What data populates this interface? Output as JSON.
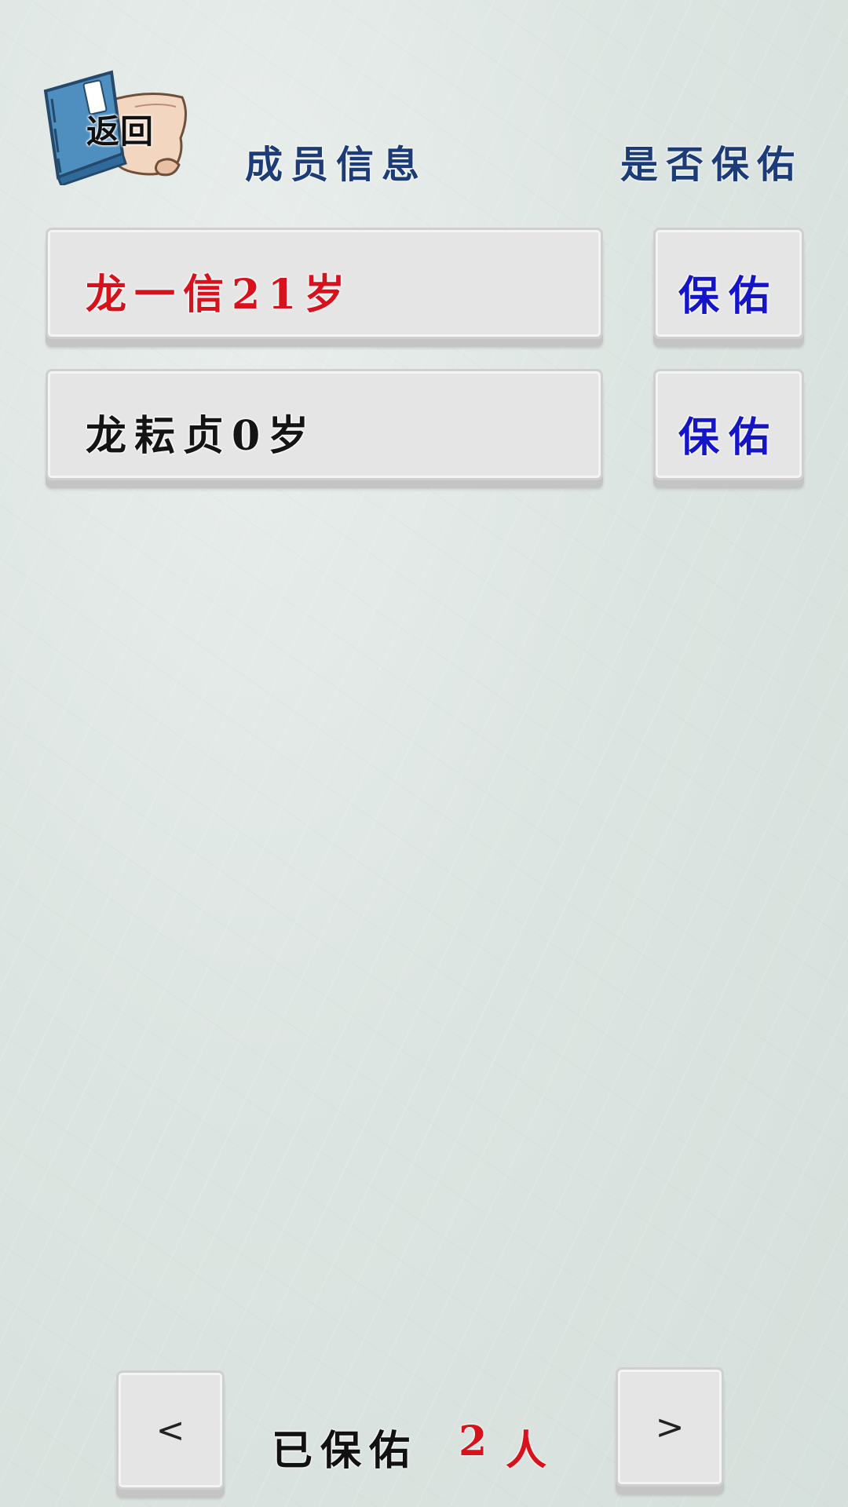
{
  "back_button": {
    "label": "返回"
  },
  "headers": {
    "member_info": "成员信息",
    "protect_column": "是否保佑"
  },
  "members": [
    {
      "name_age": "龙一信21岁",
      "color": "#d8121c",
      "action": "保佑"
    },
    {
      "name_age": "龙耘贞0岁",
      "color": "#141414",
      "action": "保佑"
    }
  ],
  "footer": {
    "prev_label": "<",
    "next_label": ">",
    "protected_label": "已保佑",
    "protected_count": "2",
    "unit": "人"
  },
  "colors": {
    "header_blue": "#1c3c78",
    "action_blue": "#1515c8",
    "highlight_red": "#d8121c"
  }
}
